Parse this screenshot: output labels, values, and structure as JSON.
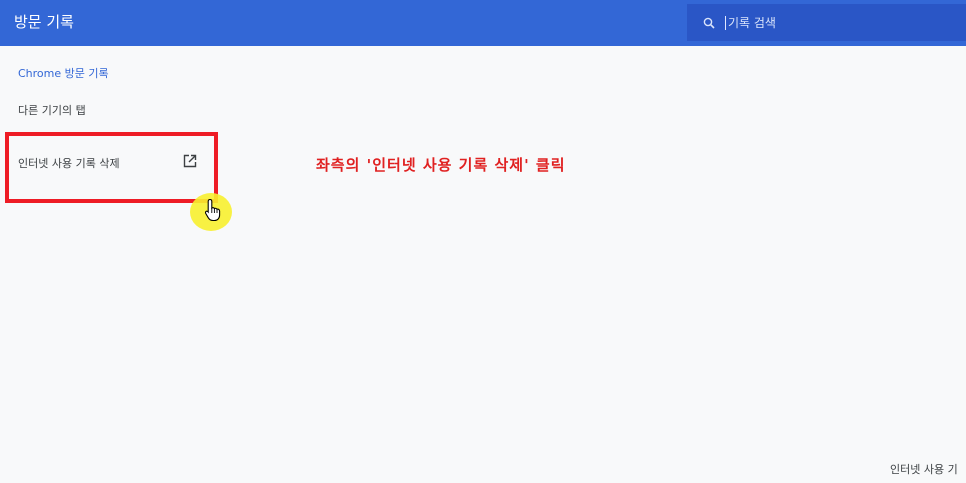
{
  "header": {
    "title": "방문 기록",
    "search": {
      "icon": "search-icon",
      "placeholder": "기록 검색"
    }
  },
  "sidebar": {
    "items": [
      {
        "label": "Chrome 방문 기록",
        "selected": true
      },
      {
        "label": "다른 기기의 탭"
      },
      {
        "label": "인터넷 사용 기록 삭제",
        "icon": "open-in-new-icon"
      }
    ]
  },
  "annotation": {
    "text": "좌측의 '인터넷 사용 기록 삭제' 클릭",
    "color": "#e02121"
  },
  "footer": {
    "text": "인터넷 사용 기"
  },
  "colors": {
    "header_bg": "#3367d6",
    "search_bg": "#2a56c6",
    "highlight": "#ee1c25",
    "cursor_halo": "#f7f02f"
  }
}
